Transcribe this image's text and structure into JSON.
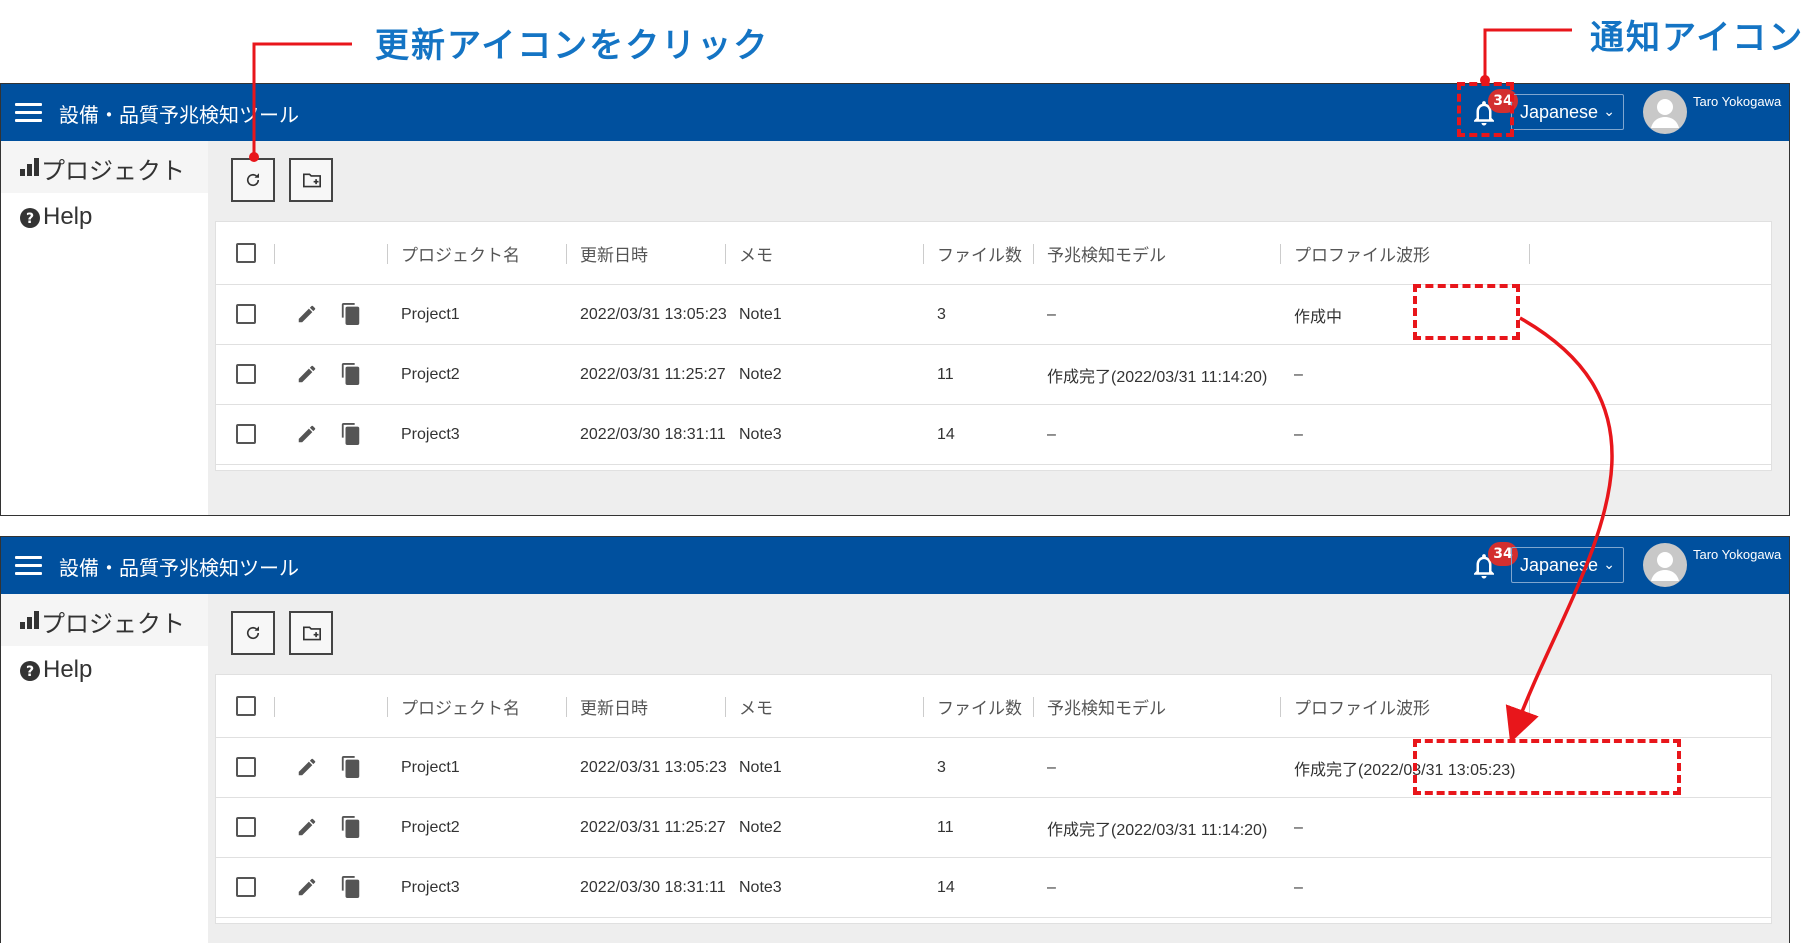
{
  "annotations": {
    "refresh_callout": "更新アイコンをクリック",
    "notification_callout": "通知アイコン"
  },
  "colors": {
    "appbar": "#00509e",
    "callout_text": "#1474c4",
    "annotation_red": "#e8161b",
    "badge": "#d32f2f"
  },
  "screens": [
    {
      "app": {
        "title": "設備・品質予兆検知ツール",
        "notification_count": "34",
        "language": "Japanese",
        "user_name": "Taro Yokogawa"
      },
      "sidebar": {
        "items": [
          {
            "label": "プロジェクト",
            "icon": "bar-chart-icon",
            "active": true
          },
          {
            "label": "Help",
            "icon": "help-icon",
            "active": false
          }
        ]
      },
      "toolbar": {
        "buttons": [
          "refresh-icon",
          "create-folder-icon"
        ]
      },
      "table": {
        "columns": [
          "プロジェクト名",
          "更新日時",
          "メモ",
          "ファイル数",
          "予兆検知モデル",
          "プロファイル波形"
        ],
        "rows": [
          {
            "name": "Project1",
            "updated": "2022/03/31 13:05:23",
            "memo": "Note1",
            "files": "3",
            "model": "–",
            "profile": "作成中"
          },
          {
            "name": "Project2",
            "updated": "2022/03/31 11:25:27",
            "memo": "Note2",
            "files": "11",
            "model": "作成完了(2022/03/31 11:14:20)",
            "profile": "–"
          },
          {
            "name": "Project3",
            "updated": "2022/03/30 18:31:11",
            "memo": "Note3",
            "files": "14",
            "model": "–",
            "profile": "–"
          }
        ]
      }
    },
    {
      "app": {
        "title": "設備・品質予兆検知ツール",
        "notification_count": "34",
        "language": "Japanese",
        "user_name": "Taro Yokogawa"
      },
      "sidebar": {
        "items": [
          {
            "label": "プロジェクト",
            "icon": "bar-chart-icon",
            "active": true
          },
          {
            "label": "Help",
            "icon": "help-icon",
            "active": false
          }
        ]
      },
      "toolbar": {
        "buttons": [
          "refresh-icon",
          "create-folder-icon"
        ]
      },
      "table": {
        "columns": [
          "プロジェクト名",
          "更新日時",
          "メモ",
          "ファイル数",
          "予兆検知モデル",
          "プロファイル波形"
        ],
        "rows": [
          {
            "name": "Project1",
            "updated": "2022/03/31 13:05:23",
            "memo": "Note1",
            "files": "3",
            "model": "–",
            "profile": "作成完了(2022/03/31 13:05:23)"
          },
          {
            "name": "Project2",
            "updated": "2022/03/31 11:25:27",
            "memo": "Note2",
            "files": "11",
            "model": "作成完了(2022/03/31 11:14:20)",
            "profile": "–"
          },
          {
            "name": "Project3",
            "updated": "2022/03/30 18:31:11",
            "memo": "Note3",
            "files": "14",
            "model": "–",
            "profile": "–"
          }
        ]
      }
    }
  ]
}
